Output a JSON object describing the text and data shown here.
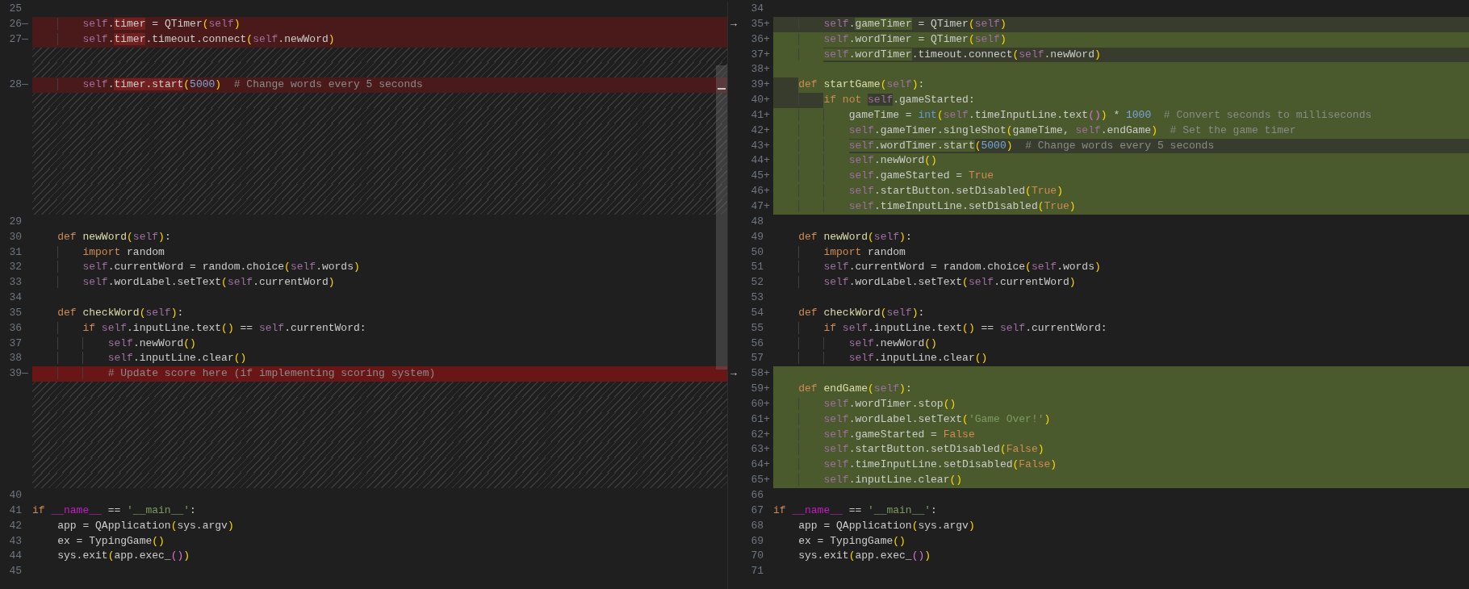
{
  "left_pane": {
    "lines": [
      {
        "number": "25",
        "kind": "context"
      },
      {
        "number": "26",
        "marker": "—",
        "kind": "removed",
        "partial": true,
        "tail_changed": false,
        "tokens": [
          {
            "text": "        self",
            "kind": "self",
            "changed": false
          },
          {
            "text": ".",
            "kind": "plain",
            "changed": false
          },
          {
            "text": "timer",
            "kind": "plain",
            "changed": true
          },
          {
            "text": " = QTimer",
            "kind": "plain",
            "changed": false
          },
          {
            "text": "(",
            "kind": "br",
            "changed": false
          },
          {
            "text": "self",
            "kind": "self",
            "changed": false
          },
          {
            "text": ")",
            "kind": "br",
            "changed": false
          }
        ]
      },
      {
        "number": "27",
        "marker": "—",
        "kind": "removed",
        "partial": true,
        "tail_changed": false,
        "tokens": [
          {
            "text": "        self",
            "kind": "self",
            "changed": false
          },
          {
            "text": ".",
            "kind": "plain",
            "changed": false
          },
          {
            "text": "timer",
            "kind": "plain",
            "changed": true
          },
          {
            "text": ".timeout.connect",
            "kind": "plain",
            "changed": false
          },
          {
            "text": "(",
            "kind": "br",
            "changed": false
          },
          {
            "text": "self",
            "kind": "self",
            "changed": false
          },
          {
            "text": ".newWord",
            "kind": "plain",
            "changed": false
          },
          {
            "text": ")",
            "kind": "br",
            "changed": false
          }
        ]
      },
      {
        "kind": "filler"
      },
      {
        "kind": "filler"
      },
      {
        "number": "28",
        "marker": "—",
        "kind": "removed",
        "partial": true,
        "tail_changed": false,
        "tokens": [
          {
            "text": "        self",
            "kind": "self",
            "changed": false
          },
          {
            "text": ".",
            "kind": "plain",
            "changed": false
          },
          {
            "text": "timer.start",
            "kind": "plain",
            "changed": true
          },
          {
            "text": "(",
            "kind": "br",
            "changed": false
          },
          {
            "text": "5000",
            "kind": "num",
            "changed": false
          },
          {
            "text": ")",
            "kind": "br",
            "changed": false
          },
          {
            "text": "  # Change words every 5 seconds",
            "kind": "com",
            "changed": false
          }
        ]
      },
      {
        "kind": "filler"
      },
      {
        "kind": "filler"
      },
      {
        "kind": "filler"
      },
      {
        "kind": "filler"
      },
      {
        "kind": "filler"
      },
      {
        "kind": "filler"
      },
      {
        "kind": "filler"
      },
      {
        "kind": "filler"
      },
      {
        "number": "29",
        "kind": "context"
      },
      {
        "number": "30",
        "kind": "context",
        "tokens": [
          {
            "text": "    def ",
            "kind": "kw"
          },
          {
            "text": "newWord",
            "kind": "fn"
          },
          {
            "text": "(",
            "kind": "br"
          },
          {
            "text": "self",
            "kind": "self"
          },
          {
            "text": ")",
            "kind": "br"
          },
          {
            "text": ":",
            "kind": "plain"
          }
        ]
      },
      {
        "number": "31",
        "kind": "context",
        "tokens": [
          {
            "text": "        import",
            "kind": "kw"
          },
          {
            "text": " random",
            "kind": "plain"
          }
        ]
      },
      {
        "number": "32",
        "kind": "context",
        "tokens": [
          {
            "text": "        self",
            "kind": "self"
          },
          {
            "text": ".currentWord = random.choice",
            "kind": "plain"
          },
          {
            "text": "(",
            "kind": "br"
          },
          {
            "text": "self",
            "kind": "self"
          },
          {
            "text": ".words",
            "kind": "plain"
          },
          {
            "text": ")",
            "kind": "br"
          }
        ]
      },
      {
        "number": "33",
        "kind": "context",
        "tokens": [
          {
            "text": "        self",
            "kind": "self"
          },
          {
            "text": ".wordLabel.setText",
            "kind": "plain"
          },
          {
            "text": "(",
            "kind": "br"
          },
          {
            "text": "self",
            "kind": "self"
          },
          {
            "text": ".currentWord",
            "kind": "plain"
          },
          {
            "text": ")",
            "kind": "br"
          }
        ]
      },
      {
        "number": "34",
        "kind": "context"
      },
      {
        "number": "35",
        "kind": "context",
        "tokens": [
          {
            "text": "    def ",
            "kind": "kw"
          },
          {
            "text": "checkWord",
            "kind": "fn"
          },
          {
            "text": "(",
            "kind": "br"
          },
          {
            "text": "self",
            "kind": "self"
          },
          {
            "text": ")",
            "kind": "br"
          },
          {
            "text": ":",
            "kind": "plain"
          }
        ]
      },
      {
        "number": "36",
        "kind": "context",
        "tokens": [
          {
            "text": "        if ",
            "kind": "kw"
          },
          {
            "text": "self",
            "kind": "self"
          },
          {
            "text": ".inputLine.text",
            "kind": "plain"
          },
          {
            "text": "()",
            "kind": "br"
          },
          {
            "text": " == ",
            "kind": "plain"
          },
          {
            "text": "self",
            "kind": "self"
          },
          {
            "text": ".currentWord:",
            "kind": "plain"
          }
        ]
      },
      {
        "number": "37",
        "kind": "context",
        "tokens": [
          {
            "text": "            self",
            "kind": "self"
          },
          {
            "text": ".newWord",
            "kind": "plain"
          },
          {
            "text": "()",
            "kind": "br"
          }
        ]
      },
      {
        "number": "38",
        "kind": "context",
        "tokens": [
          {
            "text": "            self",
            "kind": "self"
          },
          {
            "text": ".inputLine.clear",
            "kind": "plain"
          },
          {
            "text": "()",
            "kind": "br"
          }
        ]
      },
      {
        "number": "39",
        "marker": "—",
        "kind": "removed",
        "partial": false,
        "tokens": [
          {
            "text": "            # Update score here (if implementing scoring system)",
            "kind": "com"
          }
        ]
      },
      {
        "kind": "filler"
      },
      {
        "kind": "filler"
      },
      {
        "kind": "filler"
      },
      {
        "kind": "filler"
      },
      {
        "kind": "filler"
      },
      {
        "kind": "filler"
      },
      {
        "kind": "filler"
      },
      {
        "number": "40",
        "kind": "context"
      },
      {
        "number": "41",
        "kind": "context",
        "tokens": [
          {
            "text": "if ",
            "kind": "kw"
          },
          {
            "text": "__name__",
            "kind": "dunder"
          },
          {
            "text": " == ",
            "kind": "plain"
          },
          {
            "text": "'__main__'",
            "kind": "str"
          },
          {
            "text": ":",
            "kind": "plain"
          }
        ]
      },
      {
        "number": "42",
        "kind": "context",
        "tokens": [
          {
            "text": "    app = QApplication",
            "kind": "plain"
          },
          {
            "text": "(",
            "kind": "br"
          },
          {
            "text": "sys.argv",
            "kind": "plain"
          },
          {
            "text": ")",
            "kind": "br"
          }
        ]
      },
      {
        "number": "43",
        "kind": "context",
        "tokens": [
          {
            "text": "    ex = TypingGame",
            "kind": "plain"
          },
          {
            "text": "()",
            "kind": "br"
          }
        ]
      },
      {
        "number": "44",
        "kind": "context",
        "tokens": [
          {
            "text": "    sys.exit",
            "kind": "plain"
          },
          {
            "text": "(",
            "kind": "br"
          },
          {
            "text": "app.exec_",
            "kind": "plain"
          },
          {
            "text": "()",
            "kind": "br2"
          },
          {
            "text": ")",
            "kind": "br"
          }
        ]
      },
      {
        "number": "45",
        "kind": "context"
      }
    ]
  },
  "right_pane": {
    "lines": [
      {
        "number": "34",
        "kind": "context"
      },
      {
        "number": "35",
        "marker": "+",
        "arrow": "→",
        "kind": "added",
        "partial": true,
        "tail_changed": false,
        "tokens": [
          {
            "text": "        self",
            "kind": "self",
            "changed": false
          },
          {
            "text": ".",
            "kind": "plain",
            "changed": false
          },
          {
            "text": "gameTimer",
            "kind": "plain",
            "changed": true
          },
          {
            "text": " = QTimer",
            "kind": "plain",
            "changed": false
          },
          {
            "text": "(",
            "kind": "br",
            "changed": false
          },
          {
            "text": "self",
            "kind": "self",
            "changed": false
          },
          {
            "text": ")",
            "kind": "br",
            "changed": false
          }
        ]
      },
      {
        "number": "36",
        "marker": "+",
        "kind": "added",
        "partial": false,
        "tokens": [
          {
            "text": "        self",
            "kind": "self"
          },
          {
            "text": ".wordTimer = QTimer",
            "kind": "plain"
          },
          {
            "text": "(",
            "kind": "br"
          },
          {
            "text": "self",
            "kind": "self"
          },
          {
            "text": ")",
            "kind": "br"
          }
        ]
      },
      {
        "number": "37",
        "marker": "+",
        "kind": "added",
        "partial": true,
        "tail_changed": false,
        "tokens": [
          {
            "text": "        self",
            "kind": "self",
            "changed": true
          },
          {
            "text": ".wordTimer",
            "kind": "plain",
            "changed": true
          },
          {
            "text": ".timeout.connect",
            "kind": "plain",
            "changed": false
          },
          {
            "text": "(",
            "kind": "br",
            "changed": false
          },
          {
            "text": "self",
            "kind": "self",
            "changed": false
          },
          {
            "text": ".newWord",
            "kind": "plain",
            "changed": false
          },
          {
            "text": ")",
            "kind": "br",
            "changed": false
          }
        ]
      },
      {
        "number": "38",
        "marker": "+",
        "kind": "added",
        "partial": false
      },
      {
        "number": "39",
        "marker": "+",
        "kind": "added",
        "partial": true,
        "tail_changed": true,
        "indent_changed": false,
        "tokens": [
          {
            "text": "    def ",
            "kind": "kw",
            "changed": true
          },
          {
            "text": "startGame",
            "kind": "fn",
            "changed": true
          },
          {
            "text": "(",
            "kind": "br",
            "changed": true
          },
          {
            "text": "self",
            "kind": "self",
            "changed": true
          },
          {
            "text": ")",
            "kind": "br",
            "changed": true
          },
          {
            "text": ":",
            "kind": "plain",
            "changed": true
          }
        ]
      },
      {
        "number": "40",
        "marker": "+",
        "kind": "added",
        "partial": true,
        "tail_changed": true,
        "indent_changed": false,
        "tokens": [
          {
            "text": "        if not ",
            "kind": "kw",
            "changed": true
          },
          {
            "text": "self",
            "kind": "self",
            "changed": false
          },
          {
            "text": ".gameStarted:",
            "kind": "plain",
            "changed": true
          }
        ]
      },
      {
        "number": "41",
        "marker": "+",
        "kind": "added",
        "partial": false,
        "tokens": [
          {
            "text": "            gameTime = ",
            "kind": "plain"
          },
          {
            "text": "int",
            "kind": "builtin"
          },
          {
            "text": "(",
            "kind": "br"
          },
          {
            "text": "self",
            "kind": "self"
          },
          {
            "text": ".timeInputLine.text",
            "kind": "plain"
          },
          {
            "text": "()",
            "kind": "br2"
          },
          {
            "text": ")",
            "kind": "br"
          },
          {
            "text": " * ",
            "kind": "plain"
          },
          {
            "text": "1000",
            "kind": "num"
          },
          {
            "text": "  # Convert seconds to milliseconds",
            "kind": "com"
          }
        ]
      },
      {
        "number": "42",
        "marker": "+",
        "kind": "added",
        "partial": false,
        "tokens": [
          {
            "text": "            self",
            "kind": "self"
          },
          {
            "text": ".gameTimer.singleShot",
            "kind": "plain"
          },
          {
            "text": "(",
            "kind": "br"
          },
          {
            "text": "gameTime, ",
            "kind": "plain"
          },
          {
            "text": "self",
            "kind": "self"
          },
          {
            "text": ".endGame",
            "kind": "plain"
          },
          {
            "text": ")",
            "kind": "br"
          },
          {
            "text": "  # Set the game timer",
            "kind": "com"
          }
        ]
      },
      {
        "number": "43",
        "marker": "+",
        "kind": "added",
        "partial": true,
        "tail_changed": false,
        "tokens": [
          {
            "text": "            self",
            "kind": "self",
            "changed": true
          },
          {
            "text": ".wordTimer.start",
            "kind": "plain",
            "changed": true
          },
          {
            "text": "(",
            "kind": "br",
            "changed": false
          },
          {
            "text": "5000",
            "kind": "num",
            "changed": false
          },
          {
            "text": ")",
            "kind": "br",
            "changed": false
          },
          {
            "text": "  # Change words every 5 seconds",
            "kind": "com",
            "changed": false
          }
        ]
      },
      {
        "number": "44",
        "marker": "+",
        "kind": "added",
        "partial": false,
        "tokens": [
          {
            "text": "            self",
            "kind": "self"
          },
          {
            "text": ".newWord",
            "kind": "plain"
          },
          {
            "text": "()",
            "kind": "br"
          }
        ]
      },
      {
        "number": "45",
        "marker": "+",
        "kind": "added",
        "partial": false,
        "tokens": [
          {
            "text": "            self",
            "kind": "self"
          },
          {
            "text": ".gameStarted = ",
            "kind": "plain"
          },
          {
            "text": "True",
            "kind": "const"
          }
        ]
      },
      {
        "number": "46",
        "marker": "+",
        "kind": "added",
        "partial": false,
        "tokens": [
          {
            "text": "            self",
            "kind": "self"
          },
          {
            "text": ".startButton.setDisabled",
            "kind": "plain"
          },
          {
            "text": "(",
            "kind": "br"
          },
          {
            "text": "True",
            "kind": "const"
          },
          {
            "text": ")",
            "kind": "br"
          }
        ]
      },
      {
        "number": "47",
        "marker": "+",
        "kind": "added",
        "partial": false,
        "tokens": [
          {
            "text": "            self",
            "kind": "self"
          },
          {
            "text": ".timeInputLine.setDisabled",
            "kind": "plain"
          },
          {
            "text": "(",
            "kind": "br"
          },
          {
            "text": "True",
            "kind": "const"
          },
          {
            "text": ")",
            "kind": "br"
          }
        ]
      },
      {
        "number": "48",
        "kind": "context"
      },
      {
        "number": "49",
        "kind": "context",
        "tokens": [
          {
            "text": "    def ",
            "kind": "kw"
          },
          {
            "text": "newWord",
            "kind": "fn"
          },
          {
            "text": "(",
            "kind": "br"
          },
          {
            "text": "self",
            "kind": "self"
          },
          {
            "text": ")",
            "kind": "br"
          },
          {
            "text": ":",
            "kind": "plain"
          }
        ]
      },
      {
        "number": "50",
        "kind": "context",
        "tokens": [
          {
            "text": "        import",
            "kind": "kw"
          },
          {
            "text": " random",
            "kind": "plain"
          }
        ]
      },
      {
        "number": "51",
        "kind": "context",
        "tokens": [
          {
            "text": "        self",
            "kind": "self"
          },
          {
            "text": ".currentWord = random.choice",
            "kind": "plain"
          },
          {
            "text": "(",
            "kind": "br"
          },
          {
            "text": "self",
            "kind": "self"
          },
          {
            "text": ".words",
            "kind": "plain"
          },
          {
            "text": ")",
            "kind": "br"
          }
        ]
      },
      {
        "number": "52",
        "kind": "context",
        "tokens": [
          {
            "text": "        self",
            "kind": "self"
          },
          {
            "text": ".wordLabel.setText",
            "kind": "plain"
          },
          {
            "text": "(",
            "kind": "br"
          },
          {
            "text": "self",
            "kind": "self"
          },
          {
            "text": ".currentWord",
            "kind": "plain"
          },
          {
            "text": ")",
            "kind": "br"
          }
        ]
      },
      {
        "number": "53",
        "kind": "context"
      },
      {
        "number": "54",
        "kind": "context",
        "tokens": [
          {
            "text": "    def ",
            "kind": "kw"
          },
          {
            "text": "checkWord",
            "kind": "fn"
          },
          {
            "text": "(",
            "kind": "br"
          },
          {
            "text": "self",
            "kind": "self"
          },
          {
            "text": ")",
            "kind": "br"
          },
          {
            "text": ":",
            "kind": "plain"
          }
        ]
      },
      {
        "number": "55",
        "kind": "context",
        "tokens": [
          {
            "text": "        if ",
            "kind": "kw"
          },
          {
            "text": "self",
            "kind": "self"
          },
          {
            "text": ".inputLine.text",
            "kind": "plain"
          },
          {
            "text": "()",
            "kind": "br"
          },
          {
            "text": " == ",
            "kind": "plain"
          },
          {
            "text": "self",
            "kind": "self"
          },
          {
            "text": ".currentWord:",
            "kind": "plain"
          }
        ]
      },
      {
        "number": "56",
        "kind": "context",
        "tokens": [
          {
            "text": "            self",
            "kind": "self"
          },
          {
            "text": ".newWord",
            "kind": "plain"
          },
          {
            "text": "()",
            "kind": "br"
          }
        ]
      },
      {
        "number": "57",
        "kind": "context",
        "tokens": [
          {
            "text": "            self",
            "kind": "self"
          },
          {
            "text": ".inputLine.clear",
            "kind": "plain"
          },
          {
            "text": "()",
            "kind": "br"
          }
        ]
      },
      {
        "number": "58",
        "marker": "+",
        "arrow": "→",
        "kind": "added",
        "partial": false
      },
      {
        "number": "59",
        "marker": "+",
        "kind": "added",
        "partial": false,
        "tokens": [
          {
            "text": "    def ",
            "kind": "kw"
          },
          {
            "text": "endGame",
            "kind": "fn"
          },
          {
            "text": "(",
            "kind": "br"
          },
          {
            "text": "self",
            "kind": "self"
          },
          {
            "text": ")",
            "kind": "br"
          },
          {
            "text": ":",
            "kind": "plain"
          }
        ]
      },
      {
        "number": "60",
        "marker": "+",
        "kind": "added",
        "partial": false,
        "tokens": [
          {
            "text": "        self",
            "kind": "self"
          },
          {
            "text": ".wordTimer.stop",
            "kind": "plain"
          },
          {
            "text": "()",
            "kind": "br"
          }
        ]
      },
      {
        "number": "61",
        "marker": "+",
        "kind": "added",
        "partial": false,
        "tokens": [
          {
            "text": "        self",
            "kind": "self"
          },
          {
            "text": ".wordLabel.setText",
            "kind": "plain"
          },
          {
            "text": "(",
            "kind": "br"
          },
          {
            "text": "'Game Over!'",
            "kind": "str"
          },
          {
            "text": ")",
            "kind": "br"
          }
        ]
      },
      {
        "number": "62",
        "marker": "+",
        "kind": "added",
        "partial": false,
        "tokens": [
          {
            "text": "        self",
            "kind": "self"
          },
          {
            "text": ".gameStarted = ",
            "kind": "plain"
          },
          {
            "text": "False",
            "kind": "const"
          }
        ]
      },
      {
        "number": "63",
        "marker": "+",
        "kind": "added",
        "partial": false,
        "tokens": [
          {
            "text": "        self",
            "kind": "self"
          },
          {
            "text": ".startButton.setDisabled",
            "kind": "plain"
          },
          {
            "text": "(",
            "kind": "br"
          },
          {
            "text": "False",
            "kind": "const"
          },
          {
            "text": ")",
            "kind": "br"
          }
        ]
      },
      {
        "number": "64",
        "marker": "+",
        "kind": "added",
        "partial": false,
        "tokens": [
          {
            "text": "        self",
            "kind": "self"
          },
          {
            "text": ".timeInputLine.setDisabled",
            "kind": "plain"
          },
          {
            "text": "(",
            "kind": "br"
          },
          {
            "text": "False",
            "kind": "const"
          },
          {
            "text": ")",
            "kind": "br"
          }
        ]
      },
      {
        "number": "65",
        "marker": "+",
        "kind": "added",
        "partial": false,
        "tokens": [
          {
            "text": "        self",
            "kind": "self"
          },
          {
            "text": ".inputLine.clear",
            "kind": "plain"
          },
          {
            "text": "()",
            "kind": "br"
          }
        ]
      },
      {
        "number": "66",
        "kind": "context"
      },
      {
        "number": "67",
        "kind": "context",
        "tokens": [
          {
            "text": "if ",
            "kind": "kw"
          },
          {
            "text": "__name__",
            "kind": "dunder"
          },
          {
            "text": " == ",
            "kind": "plain"
          },
          {
            "text": "'__main__'",
            "kind": "str"
          },
          {
            "text": ":",
            "kind": "plain"
          }
        ]
      },
      {
        "number": "68",
        "kind": "context",
        "tokens": [
          {
            "text": "    app = QApplication",
            "kind": "plain"
          },
          {
            "text": "(",
            "kind": "br"
          },
          {
            "text": "sys.argv",
            "kind": "plain"
          },
          {
            "text": ")",
            "kind": "br"
          }
        ]
      },
      {
        "number": "69",
        "kind": "context",
        "tokens": [
          {
            "text": "    ex = TypingGame",
            "kind": "plain"
          },
          {
            "text": "()",
            "kind": "br"
          }
        ]
      },
      {
        "number": "70",
        "kind": "context",
        "tokens": [
          {
            "text": "    sys.exit",
            "kind": "plain"
          },
          {
            "text": "(",
            "kind": "br"
          },
          {
            "text": "app.exec_",
            "kind": "plain"
          },
          {
            "text": "()",
            "kind": "br2"
          },
          {
            "text": ")",
            "kind": "br"
          }
        ]
      },
      {
        "number": "71",
        "kind": "context"
      }
    ]
  }
}
